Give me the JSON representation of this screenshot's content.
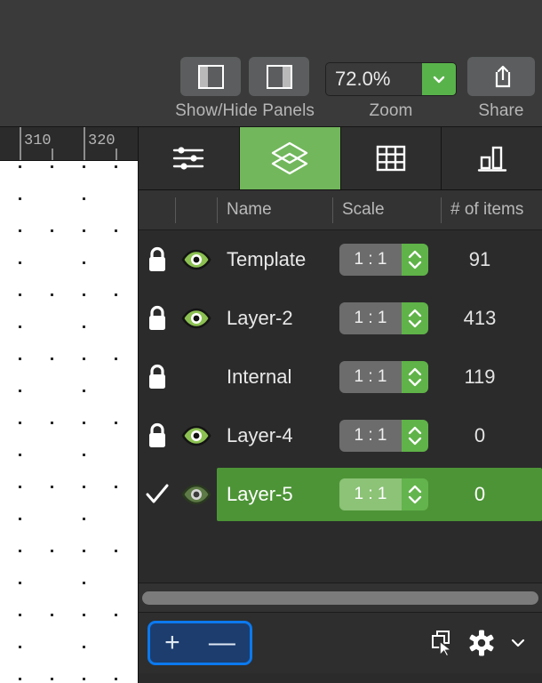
{
  "toolbar": {
    "panels": {
      "label": "Show/Hide Panels",
      "left_icon": "panel-left-icon",
      "right_icon": "panel-right-icon"
    },
    "zoom": {
      "label": "Zoom",
      "value": "72.0%",
      "dropdown_icon": "chevron-down-icon",
      "accent": "#59b34b"
    },
    "share": {
      "label": "Share",
      "icon": "share-upload-icon"
    }
  },
  "canvas": {
    "ruler": {
      "labels": [
        "310",
        "320"
      ],
      "major_ticks": [
        22,
        94
      ],
      "minor_ticks": [
        58,
        130
      ]
    }
  },
  "panel": {
    "tabs": [
      {
        "name": "tab-properties",
        "icon": "sliders-icon",
        "active": false
      },
      {
        "name": "tab-layers",
        "icon": "layers-icon",
        "active": true
      },
      {
        "name": "tab-grid",
        "icon": "grid-icon",
        "active": false
      },
      {
        "name": "tab-chart",
        "icon": "bar-chart-icon",
        "active": false
      }
    ],
    "columns": {
      "lock": "",
      "visibility": "",
      "name": "Name",
      "scale": "Scale",
      "items": "# of items"
    },
    "rows": [
      {
        "lock_icon": "lock-icon",
        "eye_icon": "eye-visible-icon",
        "name": "Template",
        "scale": "1 : 1",
        "items": "91",
        "selected": false
      },
      {
        "lock_icon": "lock-icon",
        "eye_icon": "eye-visible-icon",
        "name": "Layer-2",
        "scale": "1 : 1",
        "items": "413",
        "selected": false
      },
      {
        "lock_icon": "lock-icon",
        "eye_icon": "",
        "name": "Internal",
        "scale": "1 : 1",
        "items": "119",
        "selected": false
      },
      {
        "lock_icon": "lock-icon",
        "eye_icon": "eye-visible-icon",
        "name": "Layer-4",
        "scale": "1 : 1",
        "items": "0",
        "selected": false
      },
      {
        "lock_icon": "check-icon",
        "eye_icon": "eye-visible-icon",
        "name": "Layer-5",
        "scale": "1 : 1",
        "items": "0",
        "selected": true
      }
    ],
    "scrollbar": {
      "name": "horizontal-scrollbar"
    },
    "bottom": {
      "add_label": "+",
      "remove_label": "—",
      "duplicate_icon": "duplicate-select-icon",
      "settings_icon": "gear-icon",
      "menu_icon": "chevron-down-icon",
      "focus_color": "#0b79ef"
    }
  },
  "colors": {
    "accent_green": "#72b75c",
    "selection_green": "#4d9437",
    "toolbar_bg": "#3a3a3a",
    "panel_bg": "#2b2b2b"
  }
}
